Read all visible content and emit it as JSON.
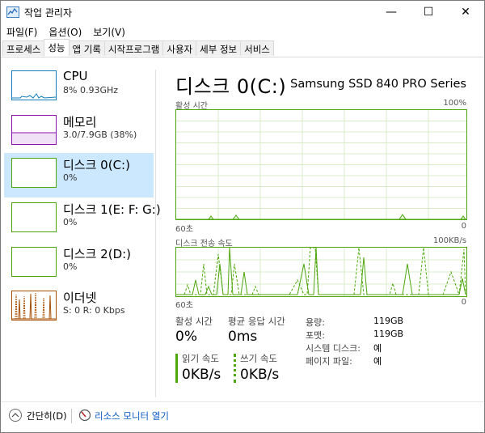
{
  "window": {
    "title": "작업 관리자",
    "minimize": "—",
    "maximize": "☐",
    "close": "✕"
  },
  "menu": [
    "파일(F)",
    "옵션(O)",
    "보기(V)"
  ],
  "tabs": [
    "프로세스",
    "성능",
    "앱 기록",
    "시작프로그램",
    "사용자",
    "세부 정보",
    "서비스"
  ],
  "active_tab": "성능",
  "resources": [
    {
      "name": "CPU",
      "value": "8% 0.93GHz",
      "color": "#117dbb",
      "selected": false
    },
    {
      "name": "메모리",
      "value": "3.0/7.9GB (38%)",
      "color": "#8b12ae",
      "selected": false
    },
    {
      "name": "디스크 0(C:)",
      "value": "0%",
      "color": "#4da60c",
      "selected": true
    },
    {
      "name": "디스크 1(E: F: G:)",
      "value": "0%",
      "color": "#4da60c",
      "selected": false
    },
    {
      "name": "디스크 2(D:)",
      "value": "0%",
      "color": "#4da60c",
      "selected": false
    },
    {
      "name": "이더넷",
      "value": "S: 0 R: 0 Kbps",
      "color": "#a74f01",
      "selected": false
    }
  ],
  "detail": {
    "title": "디스크 0(C:)",
    "model": "Samsung SSD 840 PRO Series",
    "active_graph": {
      "label": "활성 시간",
      "max": "100%",
      "time": "60초",
      "min": "0"
    },
    "transfer_graph": {
      "label": "디스크 전송 속도",
      "max": "100KB/s",
      "time": "60초",
      "min": "0"
    },
    "stats": {
      "active_time_label": "활성 시간",
      "active_time_value": "0%",
      "avg_response_label": "평균 응답 시간",
      "avg_response_value": "0ms",
      "read_label": "읽기 속도",
      "read_value": "0KB/s",
      "write_label": "쓰기 속도",
      "write_value": "0KB/s"
    },
    "info": [
      {
        "label": "용량:",
        "value": "119GB"
      },
      {
        "label": "포맷:",
        "value": "119GB"
      },
      {
        "label": "시스템 디스크:",
        "value": "예"
      },
      {
        "label": "페이지 파일:",
        "value": "예"
      }
    ]
  },
  "footer": {
    "fewer_details": "간단히(D)",
    "resource_monitor": "리소스 모니터 열기"
  },
  "colors": {
    "disk_green": "#4da60c",
    "selected_bg": "#cce8ff",
    "link_blue": "#0a5bc4"
  }
}
